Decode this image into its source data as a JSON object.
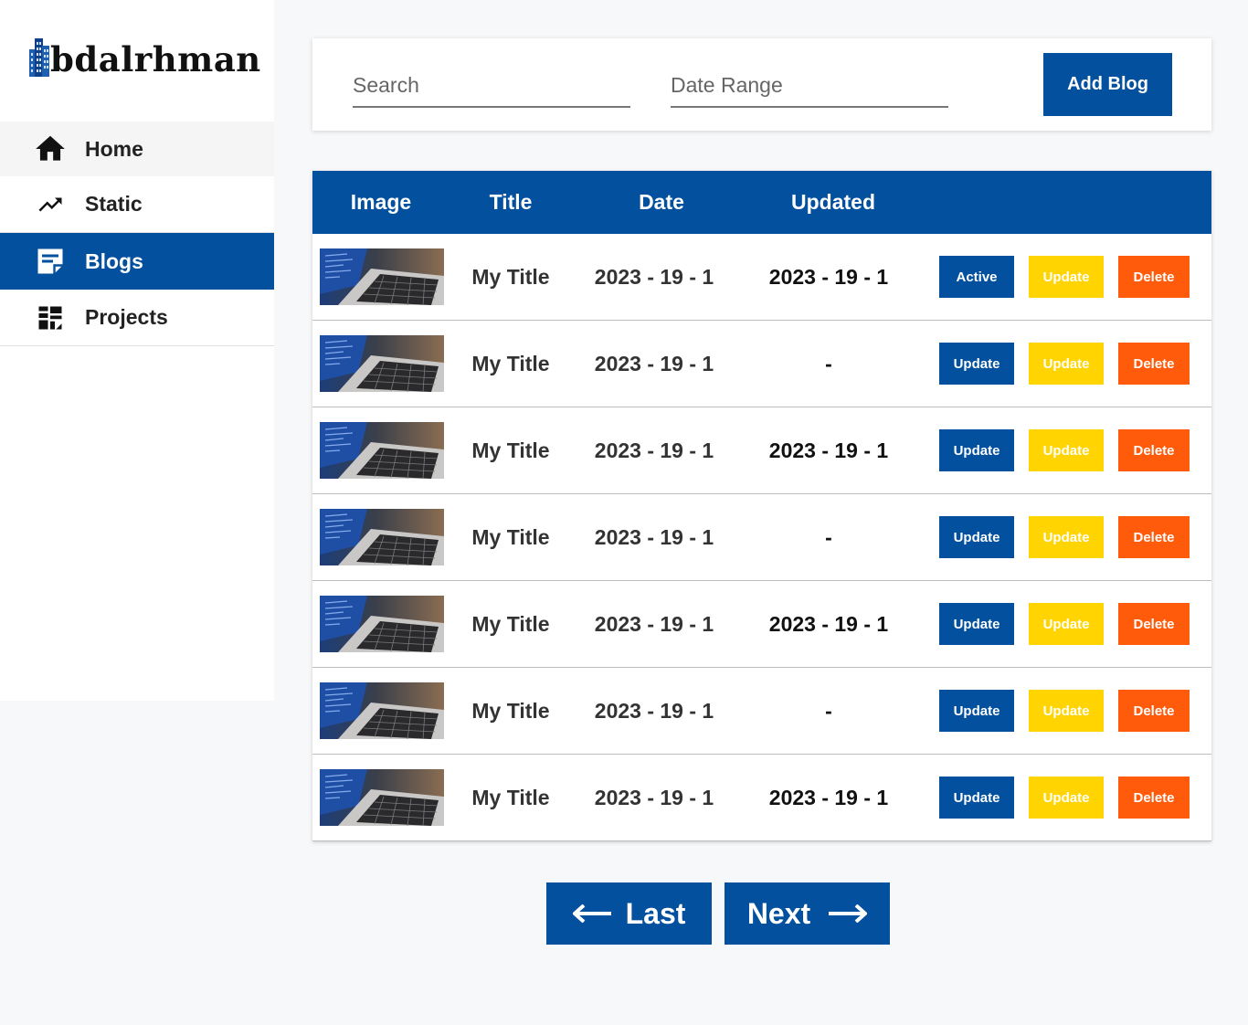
{
  "brand": {
    "name": "bdalrhman"
  },
  "sidebar": {
    "items": [
      {
        "label": "Home",
        "icon": "home-icon",
        "active": false
      },
      {
        "label": "Static",
        "icon": "trending-up-icon",
        "active": false
      },
      {
        "label": "Blogs",
        "icon": "article-icon",
        "active": true
      },
      {
        "label": "Projects",
        "icon": "dashboard-icon",
        "active": false
      }
    ]
  },
  "toolbar": {
    "search_placeholder": "Search",
    "date_range_placeholder": "Date Range",
    "add_label": "Add Blog"
  },
  "table": {
    "headers": {
      "image": "Image",
      "title": "Title",
      "date": "Date",
      "updated": "Updated"
    },
    "rows": [
      {
        "title": "My Title",
        "date": "2023 - 19 - 1",
        "updated": "2023 - 19 - 1",
        "status_label": "Active",
        "update_label": "Update",
        "delete_label": "Delete"
      },
      {
        "title": "My Title",
        "date": "2023 - 19 - 1",
        "updated": "-",
        "status_label": "Update",
        "update_label": "Update",
        "delete_label": "Delete"
      },
      {
        "title": "My Title",
        "date": "2023 - 19 - 1",
        "updated": "2023 - 19 - 1",
        "status_label": "Update",
        "update_label": "Update",
        "delete_label": "Delete"
      },
      {
        "title": "My Title",
        "date": "2023 - 19 - 1",
        "updated": "-",
        "status_label": "Update",
        "update_label": "Update",
        "delete_label": "Delete"
      },
      {
        "title": "My Title",
        "date": "2023 - 19 - 1",
        "updated": "2023 - 19 - 1",
        "status_label": "Update",
        "update_label": "Update",
        "delete_label": "Delete"
      },
      {
        "title": "My Title",
        "date": "2023 - 19 - 1",
        "updated": "-",
        "status_label": "Update",
        "update_label": "Update",
        "delete_label": "Delete"
      },
      {
        "title": "My Title",
        "date": "2023 - 19 - 1",
        "updated": "2023 - 19 - 1",
        "status_label": "Update",
        "update_label": "Update",
        "delete_label": "Delete"
      }
    ]
  },
  "pagination": {
    "prev_label": "Last",
    "next_label": "Next"
  },
  "colors": {
    "primary": "#02509e",
    "warning": "#ffd400",
    "danger": "#ff5b0a",
    "background": "#f7f8fa"
  }
}
